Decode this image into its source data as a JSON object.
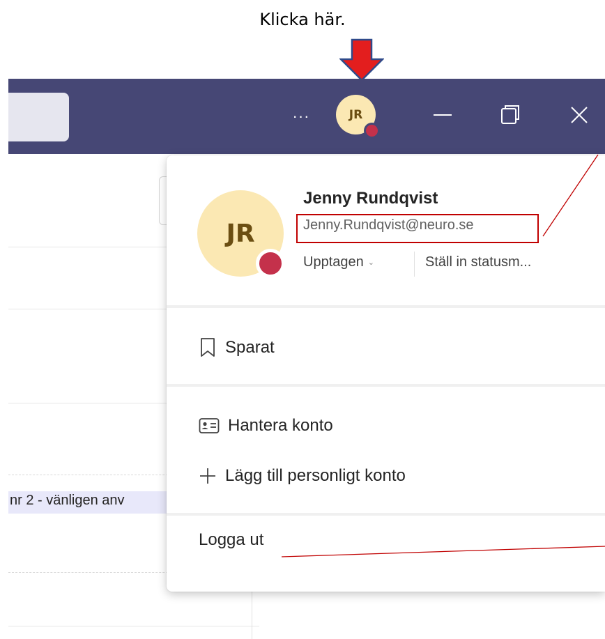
{
  "instruction": {
    "text": "Klicka här."
  },
  "titlebar": {
    "more_label": "···",
    "avatar_initials": "JR"
  },
  "background": {
    "event_text": "nr 2 - vänligen anv"
  },
  "profile": {
    "initials": "JR",
    "name": "Jenny Rundqvist",
    "email": "Jenny.Rundqvist@neuro.se",
    "status": "Upptagen",
    "status_message": "Ställ in statusm...",
    "presence_color": "#c4314b"
  },
  "menu": {
    "saved": "Sparat",
    "manage_account": "Hantera konto",
    "add_personal_account": "Lägg till personligt konto",
    "sign_out": "Logga ut"
  },
  "colors": {
    "titlebar": "#464775",
    "avatar_bg": "#fbe8b3",
    "annotation": "#c00000",
    "arrow": "#e31e1e"
  }
}
